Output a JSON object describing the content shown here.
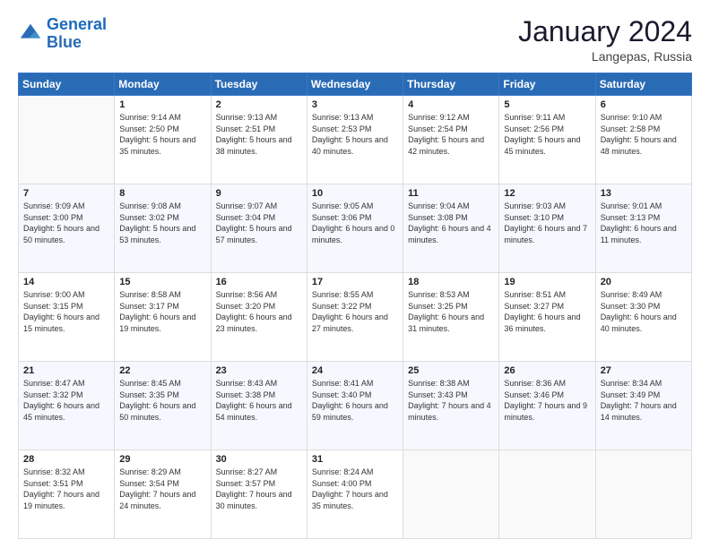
{
  "header": {
    "logo_line1": "General",
    "logo_line2": "Blue",
    "title": "January 2024",
    "subtitle": "Langepas, Russia"
  },
  "weekdays": [
    "Sunday",
    "Monday",
    "Tuesday",
    "Wednesday",
    "Thursday",
    "Friday",
    "Saturday"
  ],
  "weeks": [
    [
      {
        "day": "",
        "sunrise": "",
        "sunset": "",
        "daylight": ""
      },
      {
        "day": "1",
        "sunrise": "9:14 AM",
        "sunset": "2:50 PM",
        "daylight": "5 hours and 35 minutes."
      },
      {
        "day": "2",
        "sunrise": "9:13 AM",
        "sunset": "2:51 PM",
        "daylight": "5 hours and 38 minutes."
      },
      {
        "day": "3",
        "sunrise": "9:13 AM",
        "sunset": "2:53 PM",
        "daylight": "5 hours and 40 minutes."
      },
      {
        "day": "4",
        "sunrise": "9:12 AM",
        "sunset": "2:54 PM",
        "daylight": "5 hours and 42 minutes."
      },
      {
        "day": "5",
        "sunrise": "9:11 AM",
        "sunset": "2:56 PM",
        "daylight": "5 hours and 45 minutes."
      },
      {
        "day": "6",
        "sunrise": "9:10 AM",
        "sunset": "2:58 PM",
        "daylight": "5 hours and 48 minutes."
      }
    ],
    [
      {
        "day": "7",
        "sunrise": "9:09 AM",
        "sunset": "3:00 PM",
        "daylight": "5 hours and 50 minutes."
      },
      {
        "day": "8",
        "sunrise": "9:08 AM",
        "sunset": "3:02 PM",
        "daylight": "5 hours and 53 minutes."
      },
      {
        "day": "9",
        "sunrise": "9:07 AM",
        "sunset": "3:04 PM",
        "daylight": "5 hours and 57 minutes."
      },
      {
        "day": "10",
        "sunrise": "9:05 AM",
        "sunset": "3:06 PM",
        "daylight": "6 hours and 0 minutes."
      },
      {
        "day": "11",
        "sunrise": "9:04 AM",
        "sunset": "3:08 PM",
        "daylight": "6 hours and 4 minutes."
      },
      {
        "day": "12",
        "sunrise": "9:03 AM",
        "sunset": "3:10 PM",
        "daylight": "6 hours and 7 minutes."
      },
      {
        "day": "13",
        "sunrise": "9:01 AM",
        "sunset": "3:13 PM",
        "daylight": "6 hours and 11 minutes."
      }
    ],
    [
      {
        "day": "14",
        "sunrise": "9:00 AM",
        "sunset": "3:15 PM",
        "daylight": "6 hours and 15 minutes."
      },
      {
        "day": "15",
        "sunrise": "8:58 AM",
        "sunset": "3:17 PM",
        "daylight": "6 hours and 19 minutes."
      },
      {
        "day": "16",
        "sunrise": "8:56 AM",
        "sunset": "3:20 PM",
        "daylight": "6 hours and 23 minutes."
      },
      {
        "day": "17",
        "sunrise": "8:55 AM",
        "sunset": "3:22 PM",
        "daylight": "6 hours and 27 minutes."
      },
      {
        "day": "18",
        "sunrise": "8:53 AM",
        "sunset": "3:25 PM",
        "daylight": "6 hours and 31 minutes."
      },
      {
        "day": "19",
        "sunrise": "8:51 AM",
        "sunset": "3:27 PM",
        "daylight": "6 hours and 36 minutes."
      },
      {
        "day": "20",
        "sunrise": "8:49 AM",
        "sunset": "3:30 PM",
        "daylight": "6 hours and 40 minutes."
      }
    ],
    [
      {
        "day": "21",
        "sunrise": "8:47 AM",
        "sunset": "3:32 PM",
        "daylight": "6 hours and 45 minutes."
      },
      {
        "day": "22",
        "sunrise": "8:45 AM",
        "sunset": "3:35 PM",
        "daylight": "6 hours and 50 minutes."
      },
      {
        "day": "23",
        "sunrise": "8:43 AM",
        "sunset": "3:38 PM",
        "daylight": "6 hours and 54 minutes."
      },
      {
        "day": "24",
        "sunrise": "8:41 AM",
        "sunset": "3:40 PM",
        "daylight": "6 hours and 59 minutes."
      },
      {
        "day": "25",
        "sunrise": "8:38 AM",
        "sunset": "3:43 PM",
        "daylight": "7 hours and 4 minutes."
      },
      {
        "day": "26",
        "sunrise": "8:36 AM",
        "sunset": "3:46 PM",
        "daylight": "7 hours and 9 minutes."
      },
      {
        "day": "27",
        "sunrise": "8:34 AM",
        "sunset": "3:49 PM",
        "daylight": "7 hours and 14 minutes."
      }
    ],
    [
      {
        "day": "28",
        "sunrise": "8:32 AM",
        "sunset": "3:51 PM",
        "daylight": "7 hours and 19 minutes."
      },
      {
        "day": "29",
        "sunrise": "8:29 AM",
        "sunset": "3:54 PM",
        "daylight": "7 hours and 24 minutes."
      },
      {
        "day": "30",
        "sunrise": "8:27 AM",
        "sunset": "3:57 PM",
        "daylight": "7 hours and 30 minutes."
      },
      {
        "day": "31",
        "sunrise": "8:24 AM",
        "sunset": "4:00 PM",
        "daylight": "7 hours and 35 minutes."
      },
      {
        "day": "",
        "sunrise": "",
        "sunset": "",
        "daylight": ""
      },
      {
        "day": "",
        "sunrise": "",
        "sunset": "",
        "daylight": ""
      },
      {
        "day": "",
        "sunrise": "",
        "sunset": "",
        "daylight": ""
      }
    ]
  ]
}
